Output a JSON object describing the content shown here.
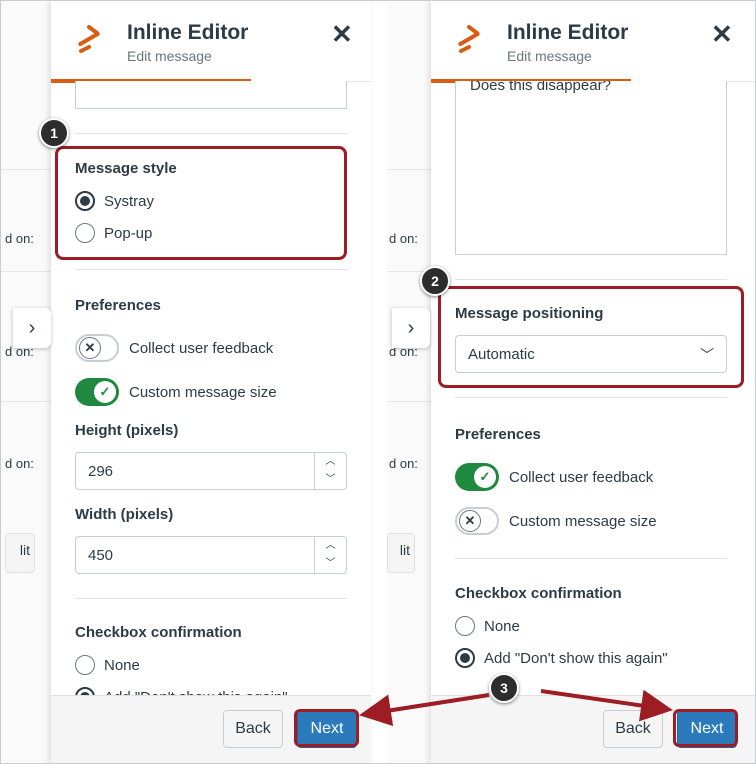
{
  "colors": {
    "accent": "#d95c13",
    "primary": "#2b7abc",
    "success": "#1f8a3f",
    "annotation": "#9e1c23"
  },
  "editor": {
    "title": "Inline Editor",
    "subtitle": "Edit message",
    "close_icon": "close-icon"
  },
  "background": {
    "enabled_on": "d on:",
    "edit_stub": "lit"
  },
  "left_panel": {
    "message_style": {
      "title": "Message style",
      "options": [
        {
          "label": "Systray",
          "selected": true
        },
        {
          "label": "Pop-up",
          "selected": false
        }
      ]
    },
    "preferences": {
      "title": "Preferences",
      "toggles": [
        {
          "label": "Collect user feedback",
          "on": false
        },
        {
          "label": "Custom message size",
          "on": true
        }
      ]
    },
    "height": {
      "label": "Height (pixels)",
      "value": "296"
    },
    "width": {
      "label": "Width (pixels)",
      "value": "450"
    },
    "checkbox_confirmation": {
      "title": "Checkbox confirmation",
      "options": [
        {
          "label": "None",
          "selected": false
        },
        {
          "label": "Add \"Don't show this again\"",
          "selected": true
        }
      ]
    }
  },
  "right_panel": {
    "textarea_value": "Does this disappear?",
    "positioning": {
      "title": "Message positioning",
      "value": "Automatic"
    },
    "preferences": {
      "title": "Preferences",
      "toggles": [
        {
          "label": "Collect user feedback",
          "on": true
        },
        {
          "label": "Custom message size",
          "on": false
        }
      ]
    },
    "checkbox_confirmation": {
      "title": "Checkbox confirmation",
      "options": [
        {
          "label": "None",
          "selected": false
        },
        {
          "label": "Add \"Don't show this again\"",
          "selected": true
        }
      ]
    }
  },
  "footer": {
    "back_label": "Back",
    "next_label": "Next"
  },
  "callouts": {
    "one": "1",
    "two": "2",
    "three": "3"
  }
}
